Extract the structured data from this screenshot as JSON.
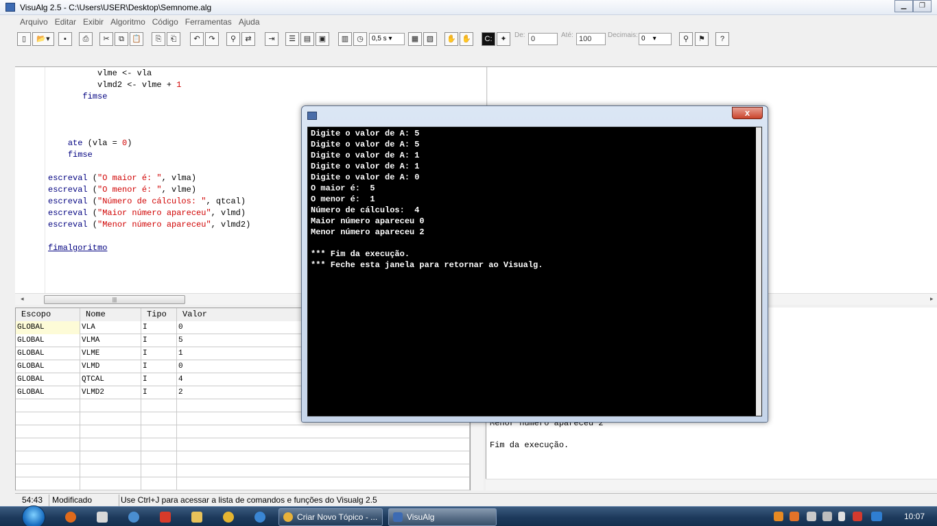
{
  "window": {
    "title": "VisuAlg 2.5 - C:\\Users\\USER\\Desktop\\Semnome.alg",
    "minimize_icon": "minimize-icon",
    "maximize_icon": "maximize-icon"
  },
  "menu": [
    "Arquivo",
    "Editar",
    "Exibir",
    "Algoritmo",
    "Código",
    "Ferramentas",
    "Ajuda"
  ],
  "toolbar": {
    "speed_value": "0,5 s",
    "de_label": "De:",
    "de_value": "0",
    "ate_label": "Até:",
    "ate_value": "100",
    "decimais_label": "Decimais:",
    "decimais_value": "0"
  },
  "code_lines": [
    {
      "indent": "          ",
      "parts": [
        {
          "t": "vlme <- vla",
          "c": "plain"
        }
      ]
    },
    {
      "indent": "          ",
      "parts": [
        {
          "t": "vlmd2 <- vlme + ",
          "c": "plain"
        },
        {
          "t": "1",
          "c": "num"
        }
      ]
    },
    {
      "indent": "       ",
      "parts": [
        {
          "t": "fimse",
          "c": "kw"
        }
      ]
    },
    {
      "indent": "",
      "parts": []
    },
    {
      "indent": "",
      "parts": []
    },
    {
      "indent": "",
      "parts": []
    },
    {
      "indent": "    ",
      "parts": [
        {
          "t": "ate",
          "c": "kw"
        },
        {
          "t": " (vla = ",
          "c": "plain"
        },
        {
          "t": "0",
          "c": "num"
        },
        {
          "t": ")",
          "c": "plain"
        }
      ]
    },
    {
      "indent": "    ",
      "parts": [
        {
          "t": "fimse",
          "c": "kw"
        }
      ]
    },
    {
      "indent": "",
      "parts": []
    },
    {
      "indent": "",
      "parts": [
        {
          "t": "escreval",
          "c": "kw"
        },
        {
          "t": " (",
          "c": "plain"
        },
        {
          "t": "\"O maior é: \"",
          "c": "str"
        },
        {
          "t": ", vlma)",
          "c": "plain"
        }
      ]
    },
    {
      "indent": "",
      "parts": [
        {
          "t": "escreval",
          "c": "kw"
        },
        {
          "t": " (",
          "c": "plain"
        },
        {
          "t": "\"O menor é: \"",
          "c": "str"
        },
        {
          "t": ", vlme)",
          "c": "plain"
        }
      ]
    },
    {
      "indent": "",
      "parts": [
        {
          "t": "escreval",
          "c": "kw"
        },
        {
          "t": " (",
          "c": "plain"
        },
        {
          "t": "\"Número de cálculos: \"",
          "c": "str"
        },
        {
          "t": ", qtcal)",
          "c": "plain"
        }
      ]
    },
    {
      "indent": "",
      "parts": [
        {
          "t": "escreval",
          "c": "kw"
        },
        {
          "t": " (",
          "c": "plain"
        },
        {
          "t": "\"Maior número apareceu\"",
          "c": "str"
        },
        {
          "t": ", vlmd)",
          "c": "plain"
        }
      ]
    },
    {
      "indent": "",
      "parts": [
        {
          "t": "escreval",
          "c": "kw"
        },
        {
          "t": " (",
          "c": "plain"
        },
        {
          "t": "\"Menor número apareceu\"",
          "c": "str"
        },
        {
          "t": ", vlmd2)",
          "c": "plain"
        }
      ]
    },
    {
      "indent": "",
      "parts": []
    },
    {
      "indent": "",
      "parts": [
        {
          "t": "fimalgoritmo",
          "c": "lnk"
        }
      ]
    }
  ],
  "variables": {
    "headers": [
      "Escopo",
      "Nome",
      "Tipo",
      "Valor"
    ],
    "rows": [
      [
        "GLOBAL",
        "VLA",
        "I",
        "0"
      ],
      [
        "GLOBAL",
        "VLMA",
        "I",
        "5"
      ],
      [
        "GLOBAL",
        "VLME",
        "I",
        "1"
      ],
      [
        "GLOBAL",
        "VLMD",
        "I",
        "0"
      ],
      [
        "GLOBAL",
        "QTCAL",
        "I",
        "4"
      ],
      [
        "GLOBAL",
        "VLMD2",
        "I",
        "2"
      ]
    ],
    "empty_rows": 7
  },
  "output_pane_lines": [
    "Menor número apareceu 2",
    "",
    "Fim da execução."
  ],
  "console": {
    "close_label": "x",
    "lines": [
      "Digite o valor de A: 5",
      "Digite o valor de A: 5",
      "Digite o valor de A: 1",
      "Digite o valor de A: 1",
      "Digite o valor de A: 0",
      "O maior é:  5",
      "O menor é:  1",
      "Número de cálculos:  4",
      "Maior número apareceu 0",
      "Menor número apareceu 2",
      "",
      "*** Fim da execução.",
      "*** Feche esta janela para retornar ao Visualg."
    ]
  },
  "status": {
    "position": "54:43",
    "modified": "Modificado",
    "hint": "Use Ctrl+J para acessar a lista de comandos e funções do Visualg 2.5"
  },
  "taskbar": {
    "items": [
      {
        "label": "Criar Novo Tópico - ...",
        "icon": "chrome-icon",
        "color": "#e8b23a"
      },
      {
        "label": "VisuAlg",
        "icon": "visualg-icon",
        "color": "#3d6bb3"
      }
    ],
    "clock": "10:07"
  },
  "colors": {
    "keyword": "#000080",
    "string": "#d00000",
    "console_bg": "#000000",
    "console_text": "#ffffff"
  }
}
